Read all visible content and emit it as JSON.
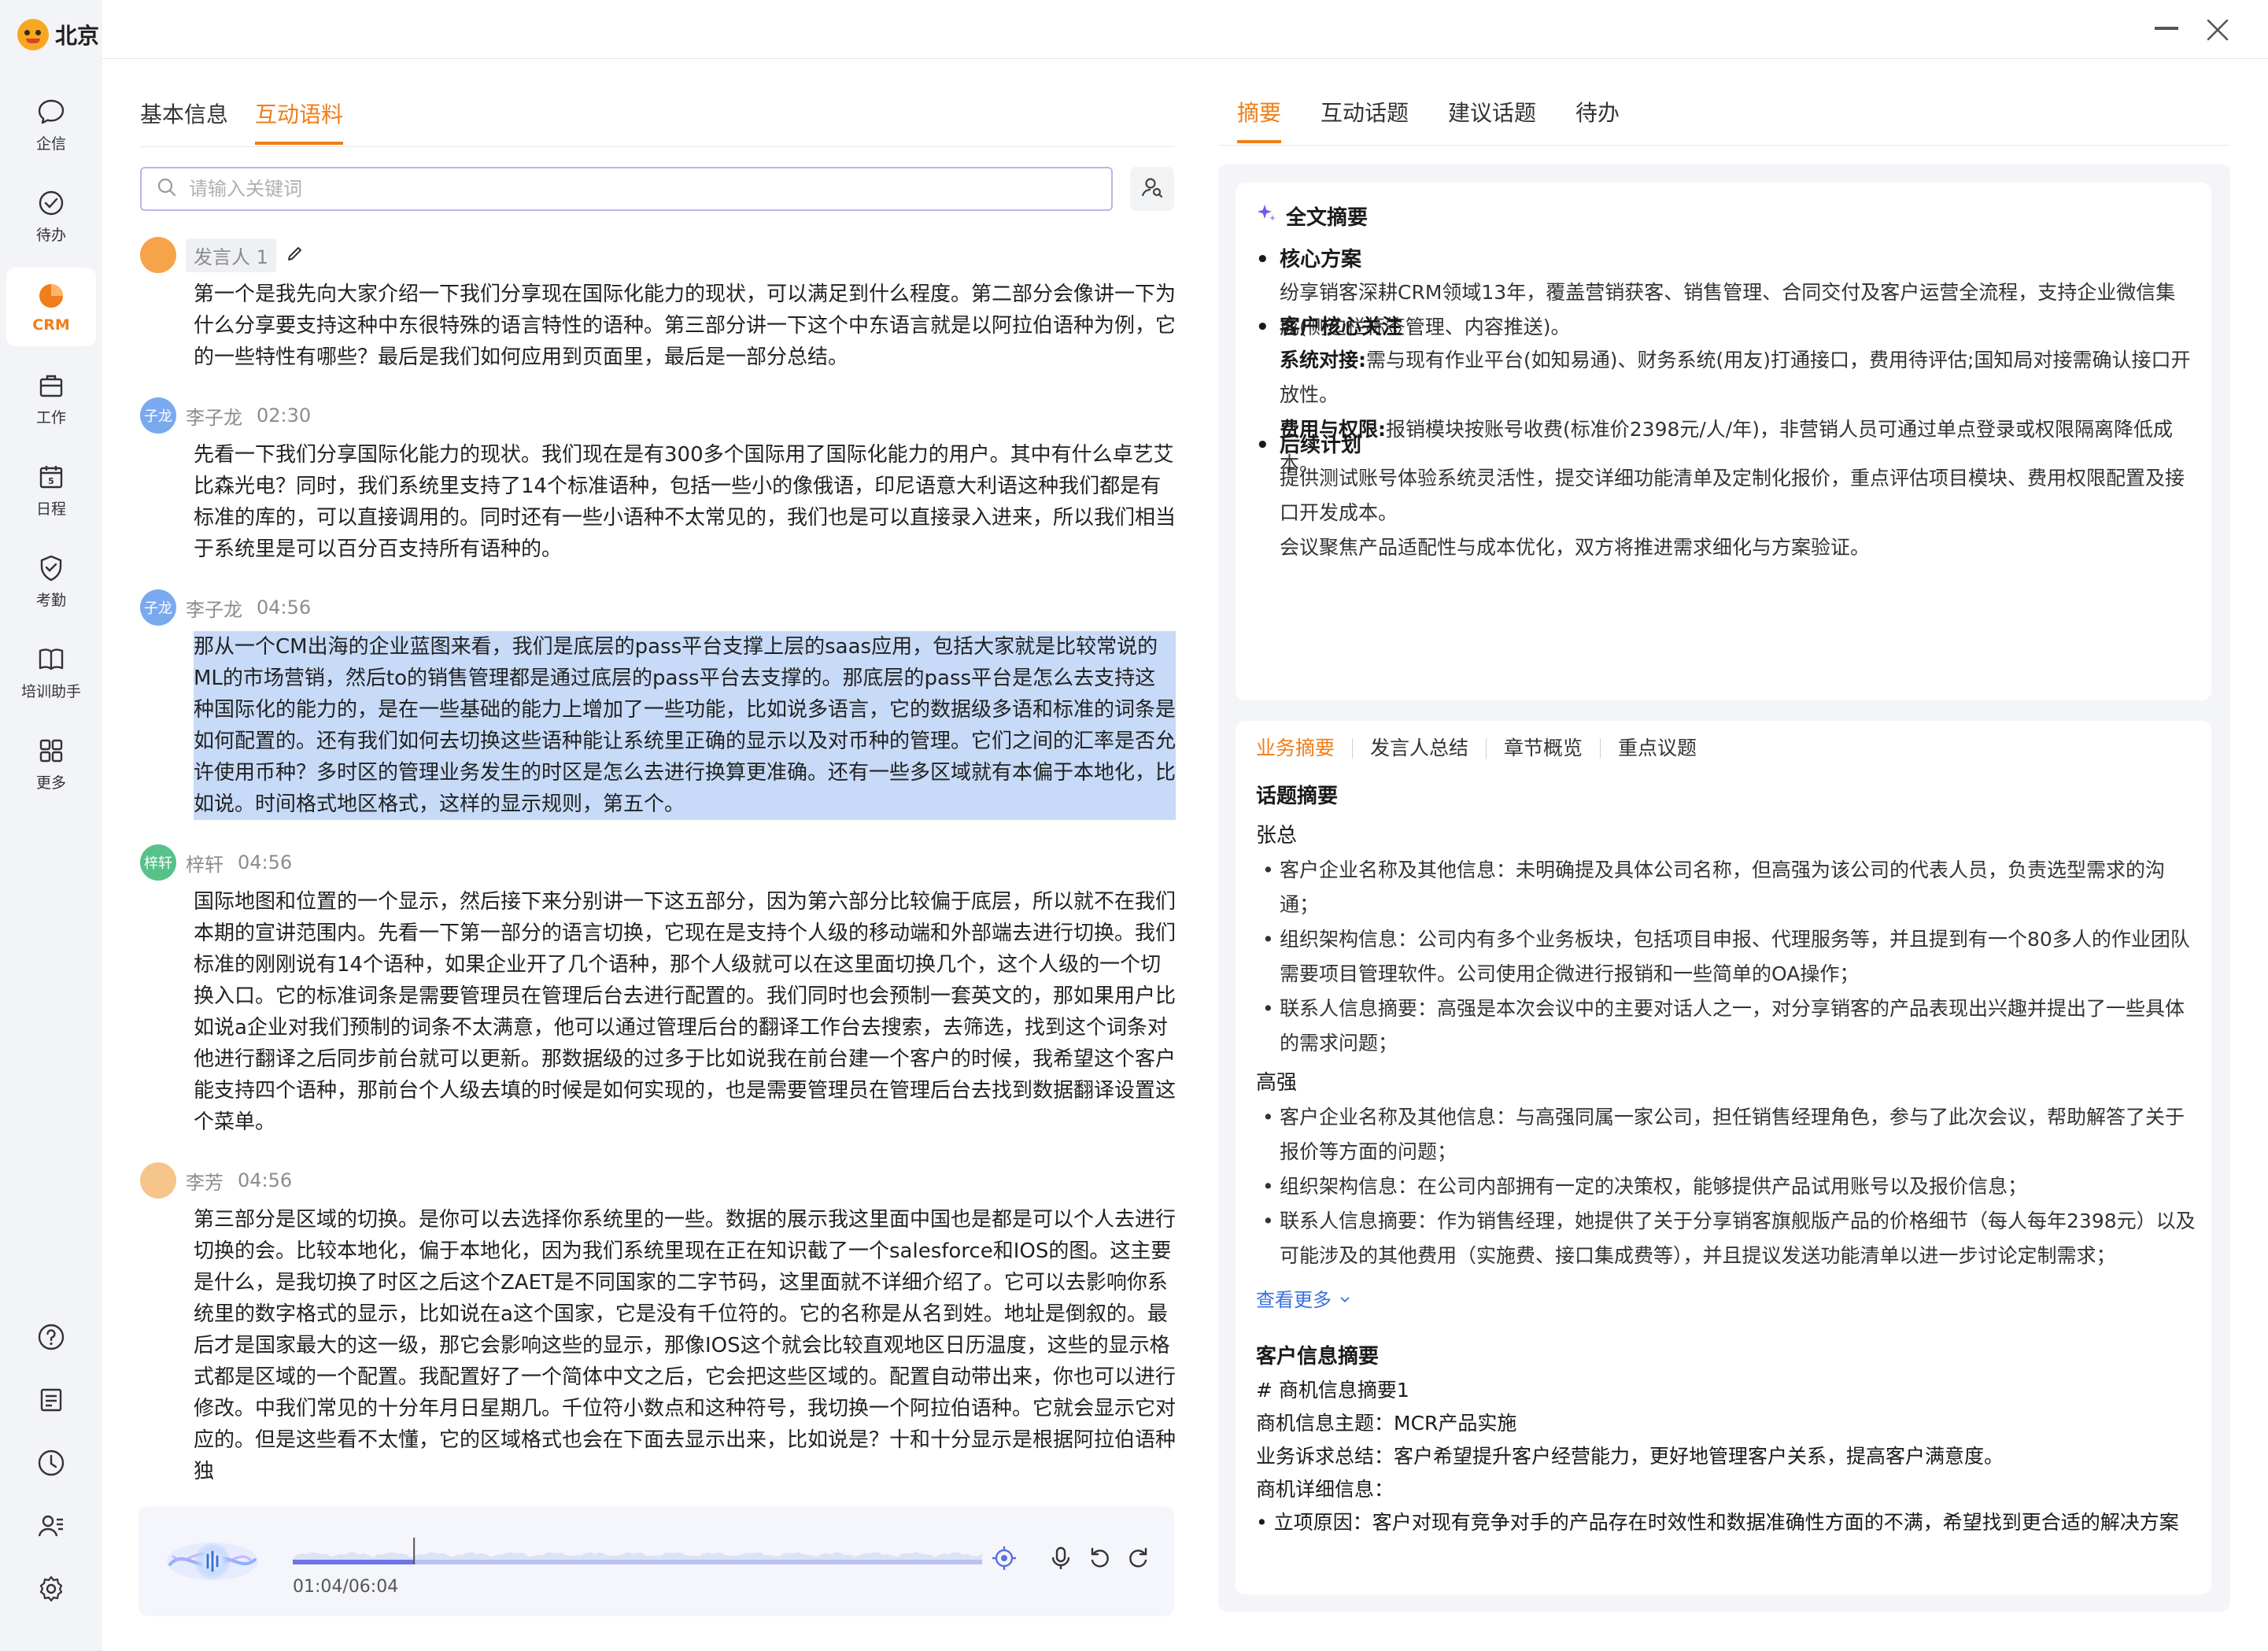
{
  "app": {
    "title": "北京"
  },
  "sidebar": {
    "items": [
      {
        "label": "企信",
        "icon": "chat-bubble-icon"
      },
      {
        "label": "待办",
        "icon": "check-circle-icon"
      },
      {
        "label": "CRM",
        "icon": "pie-chart-icon"
      },
      {
        "label": "工作",
        "icon": "briefcase-icon"
      },
      {
        "label": "日程",
        "icon": "calendar-icon"
      },
      {
        "label": "考勤",
        "icon": "checkin-badge-icon"
      },
      {
        "label": "培训助手",
        "icon": "book-icon"
      },
      {
        "label": "更多",
        "icon": "grid-icon"
      }
    ],
    "active": "CRM",
    "bottom_icons": [
      "help-icon",
      "notes-icon",
      "history-icon",
      "contacts-icon",
      "settings-icon"
    ]
  },
  "left": {
    "tabs": [
      "基本信息",
      "互动语料"
    ],
    "active_tab": "互动语料",
    "search_placeholder": "请输入关键词"
  },
  "transcript": [
    {
      "speaker": "发言人 1",
      "time": "",
      "avatar_text": "",
      "avatar_color": "#f7a34a",
      "editable": true,
      "highlight": false,
      "text": "第一个是我先向大家介绍一下我们分享现在国际化能力的现状，可以满足到什么程度。第二部分会像讲一下为什么分享要支持这种中东很特殊的语言特性的语种。第三部分讲一下这个中东语言就是以阿拉伯语种为例，它的一些特性有哪些？最后是我们如何应用到页面里，最后是一部分总结。"
    },
    {
      "speaker": "李子龙",
      "time": "02:30",
      "avatar_text": "子龙",
      "avatar_color": "#7aa9f0",
      "editable": false,
      "highlight": false,
      "text": "先看一下我们分享国际化能力的现状。我们现在是有300多个国际用了国际化能力的用户。其中有什么卓艺艾比森光电？同时，我们系统里支持了14个标准语种，包括一些小的像俄语，印尼语意大利语这种我们都是有标准的库的，可以直接调用的。同时还有一些小语种不太常见的，我们也是可以直接录入进来，所以我们相当于系统里是可以百分百支持所有语种的。"
    },
    {
      "speaker": "李子龙",
      "time": "04:56",
      "avatar_text": "子龙",
      "avatar_color": "#7aa9f0",
      "editable": false,
      "highlight": true,
      "text": "那从一个CM出海的企业蓝图来看，我们是底层的pass平台支撑上层的saas应用，包括大家就是比较常说的ML的市场营销，然后to的销售管理都是通过底层的pass平台去支撑的。那底层的pass平台是怎么去支持这种国际化的能力的，是在一些基础的能力上增加了一些功能，比如说多语言，它的数据级多语和标准的词条是如何配置的。还有我们如何去切换这些语种能让系统里正确的显示以及对币种的管理。它们之间的汇率是否允许使用币种？多时区的管理业务发生的时区是怎么去进行换算更准确。还有一些多区域就有本偏于本地化，比如说。时间格式地区格式，这样的显示规则，第五个。"
    },
    {
      "speaker": "梓轩",
      "time": "04:56",
      "avatar_text": "梓轩",
      "avatar_color": "#56c28a",
      "editable": false,
      "highlight": false,
      "text": "国际地图和位置的一个显示，然后接下来分别讲一下这五部分，因为第六部分比较偏于底层，所以就不在我们本期的宣讲范围内。先看一下第一部分的语言切换，它现在是支持个人级的移动端和外部端去进行切换。我们标准的刚刚说有14个语种，如果企业开了几个语种，那个人级就可以在这里面切换几个，这个人级的一个切换入口。它的标准词条是需要管理员在管理后台去进行配置的。我们同时也会预制一套英文的，那如果用户比如说a企业对我们预制的词条不太满意，他可以通过管理后台的翻译工作台去搜索，去筛选，找到这个词条对他进行翻译之后同步前台就可以更新。那数据级的过多于比如说我在前台建一个客户的时候，我希望这个客户能支持四个语种，那前台个人级去填的时候是如何实现的，也是需要管理员在管理后台去找到数据翻译设置这个菜单。"
    },
    {
      "speaker": "李芳",
      "time": "04:56",
      "avatar_text": "",
      "avatar_color": "#f6c58a",
      "editable": false,
      "highlight": false,
      "text": "第三部分是区域的切换。是你可以去选择你系统里的一些。数据的展示我这里面中国也是都是可以个人去进行切换的会。比较本地化，偏于本地化，因为我们系统里现在正在知识截了一个salesforce和IOS的图。这主要是什么，是我切换了时区之后这个ZAET是不同国家的二字节码，这里面就不详细介绍了。它可以去影响你系统里的数字格式的显示，比如说在a这个国家，它是没有千位符的。它的名称是从名到姓。地址是倒叙的。最后才是国家最大的这一级，那它会影响这些的显示，那像IOS这个就会比较直观地区日历温度，这些的显示格式都是区域的一个配置。我配置好了一个简体中文之后，它会把这些区域的。配置自动带出来，你也可以进行修改。中我们常见的十分年月日星期几。千位符小数点和这种符号，我切换一个阿拉伯语种。它就会显示它对应的。但是这些看不太懂，它的区域格式也会在下面去显示出来，比如说是？十和十分显示是根据阿拉伯语种独"
    }
  ],
  "player": {
    "time": "01:04/06:04",
    "progress": 0.176
  },
  "right": {
    "tabs": [
      "摘要",
      "互动话题",
      "建议话题",
      "待办"
    ],
    "active_tab": "摘要",
    "summary": {
      "title": "全文摘要",
      "sections": [
        {
          "heading": "核心方案",
          "paras": [
            {
              "bold": "",
              "text": "纷享销客深耕CRM领域13年，覆盖营销获客、销售管理、合同交付及客户运营全流程，支持企业微信集成(侧边栏标签管理、内容推送)。"
            }
          ]
        },
        {
          "heading": "客户核心关注",
          "paras": [
            {
              "bold": "系统对接:",
              "text": "需与现有作业平台(如知易通)、财务系统(用友)打通接口，费用待评估;国知局对接需确认接口开放性。"
            },
            {
              "bold": "费用与权限:",
              "text": "报销模块按账号收费(标准价2398元/人/年)，非营销人员可通过单点登录或权限隔离降低成本。"
            }
          ]
        },
        {
          "heading": "后续计划",
          "paras": [
            {
              "bold": "",
              "text": "提供测试账号体验系统灵活性，提交详细功能清单及定制化报价，重点评估项目模块、费用权限配置及接口开发成本。"
            },
            {
              "bold": "",
              "text": "会议聚焦产品适配性与成本优化，双方将推进需求细化与方案验证。"
            }
          ]
        }
      ]
    },
    "business": {
      "subtabs": [
        "业务摘要",
        "发言人总结",
        "章节概览",
        "重点议题"
      ],
      "active_subtab": "业务摘要",
      "topic_title": "话题摘要",
      "people": [
        {
          "name": "张总",
          "items": [
            "客户企业名称及其他信息：未明确提及具体公司名称，但高强为该公司的代表人员，负责选型需求的沟通；",
            "组织架构信息：公司内有多个业务板块，包括项目申报、代理服务等，并且提到有一个80多人的作业团队需要项目管理软件。公司使用企微进行报销和一些简单的OA操作；",
            "联系人信息摘要：高强是本次会议中的主要对话人之一，对分享销客的产品表现出兴趣并提出了一些具体的需求问题；"
          ]
        },
        {
          "name": "高强",
          "items": [
            "客户企业名称及其他信息：与高强同属一家公司，担任销售经理角色，参与了此次会议，帮助解答了关于报价等方面的问题；",
            "组织架构信息：在公司内部拥有一定的决策权，能够提供产品试用账号以及报价信息；",
            "联系人信息摘要：作为销售经理，她提供了关于分享销客旗舰版产品的价格细节（每人每年2398元）以及可能涉及的其他费用（实施费、接口集成费等），并且提议发送功能清单以进一步讨论定制需求；"
          ]
        }
      ],
      "more_label": "查看更多",
      "customer_title": "客户信息摘要",
      "lines": [
        "# 商机信息摘要1",
        "商机信息主题：MCR产品实施",
        "业务诉求总结：客户希望提升客户经营能力，更好地管理客户关系，提高客户满意度。",
        "商机详细信息：",
        "• 立项原因：客户对现有竞争对手的产品存在时效性和数据准确性方面的不满，希望找到更合适的解决方案"
      ]
    }
  },
  "colors": {
    "accent": "#f07e1a",
    "link": "#3b6fe0",
    "highlight": "#c7daf7"
  }
}
